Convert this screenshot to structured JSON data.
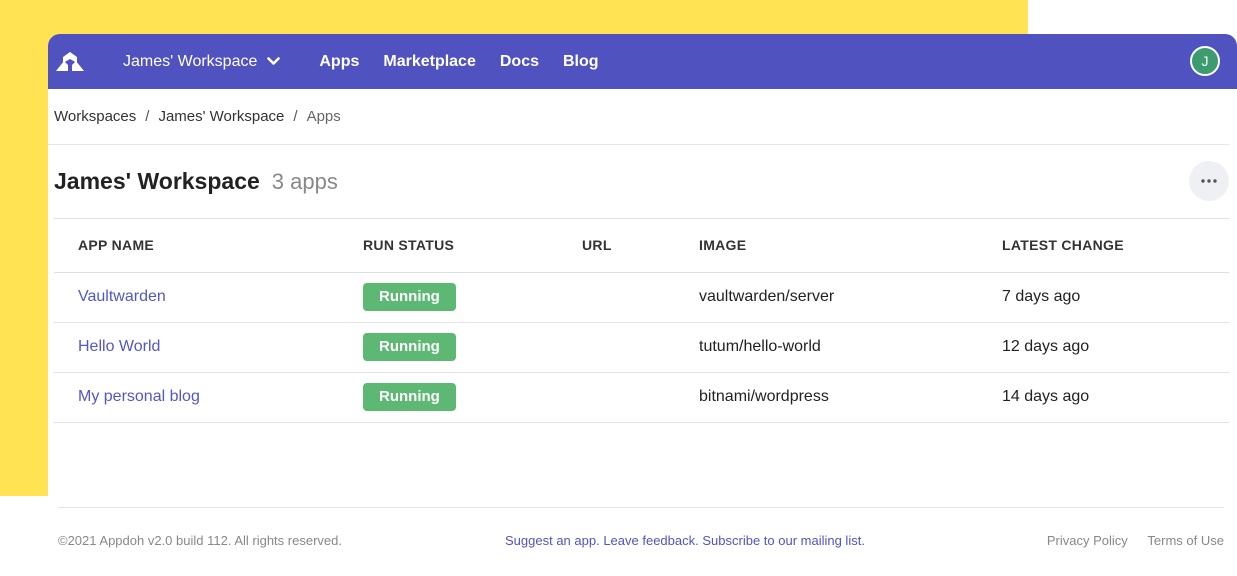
{
  "nav": {
    "workspace": "James' Workspace",
    "links": [
      "Apps",
      "Marketplace",
      "Docs",
      "Blog"
    ],
    "avatar_initial": "J"
  },
  "breadcrumb": {
    "items": [
      "Workspaces",
      "James' Workspace",
      "Apps"
    ],
    "separator": "/"
  },
  "header": {
    "title": "James' Workspace",
    "count": "3 apps"
  },
  "table": {
    "columns": [
      "APP NAME",
      "RUN STATUS",
      "URL",
      "IMAGE",
      "LATEST CHANGE"
    ],
    "rows": [
      {
        "name": "Vaultwarden",
        "status": "Running",
        "url": "",
        "image": "vaultwarden/server",
        "changed": "7 days ago"
      },
      {
        "name": "Hello World",
        "status": "Running",
        "url": "",
        "image": "tutum/hello-world",
        "changed": "12 days ago"
      },
      {
        "name": "My personal blog",
        "status": "Running",
        "url": "",
        "image": "bitnami/wordpress",
        "changed": "14 days ago"
      }
    ]
  },
  "footer": {
    "copyright": "©2021 Appdoh v2.0 build 112. All rights reserved.",
    "suggest": "Suggest an app.",
    "feedback": "Leave feedback.",
    "subscribe": "Subscribe to our mailing list.",
    "privacy": "Privacy Policy",
    "terms": "Terms of Use"
  },
  "colors": {
    "brand": "#4f52bf",
    "accent_yellow": "#ffe352",
    "status_running": "#5cb872",
    "link": "#5356c6"
  },
  "icons": {
    "logo": "appdoh-logo-icon",
    "dropdown": "chevron-down-icon",
    "more": "more-horizontal-icon"
  }
}
